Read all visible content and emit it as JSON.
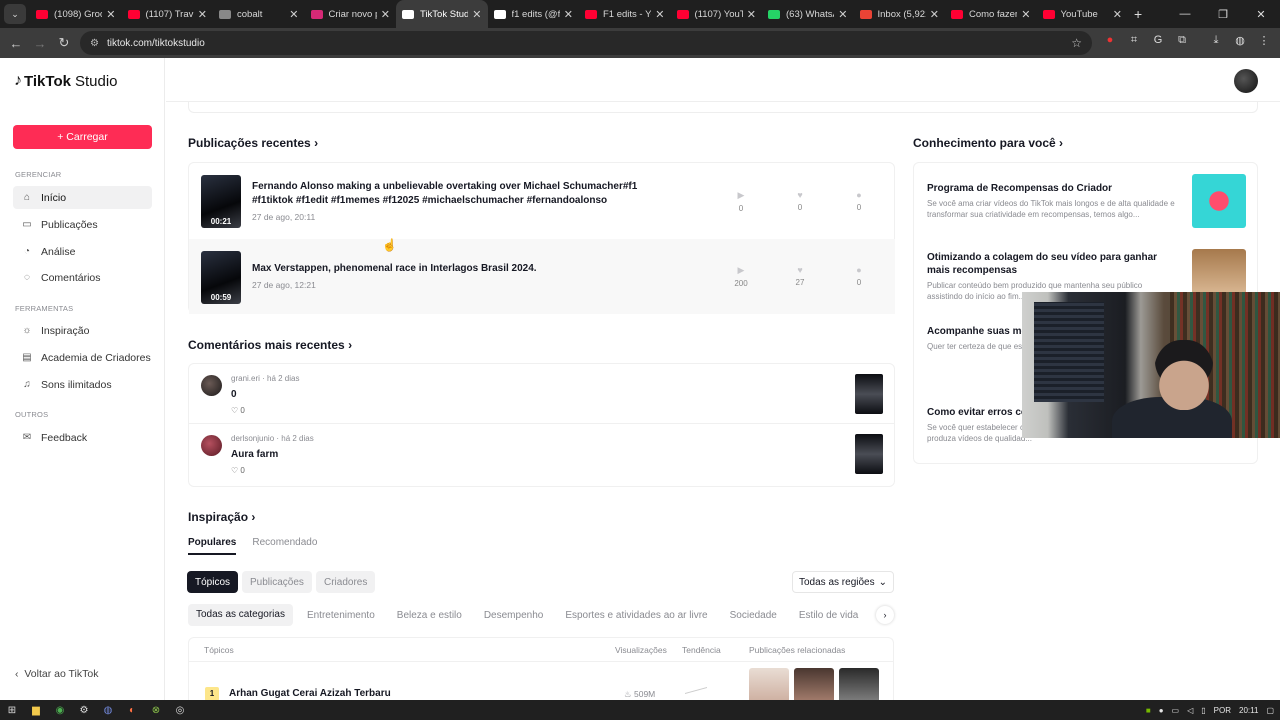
{
  "browser": {
    "tabs": [
      {
        "title": "(1098) Groo",
        "color": "#ff0033"
      },
      {
        "title": "(1107) Travis",
        "color": "#ff0033"
      },
      {
        "title": "cobalt",
        "color": "#888888"
      },
      {
        "title": "Criar novo p",
        "color": "#d62976"
      },
      {
        "title": "TikTok Studio",
        "color": "#ffffff",
        "active": true
      },
      {
        "title": "f1 edits (@f",
        "color": "#ffffff"
      },
      {
        "title": "F1 edits - Yo",
        "color": "#ff0033"
      },
      {
        "title": "(1107) YouTu",
        "color": "#ff0033"
      },
      {
        "title": "(63) WhatsA",
        "color": "#25d366"
      },
      {
        "title": "Inbox (5,921",
        "color": "#ea4335"
      },
      {
        "title": "Como fazer",
        "color": "#ff0033"
      },
      {
        "title": "YouTube",
        "color": "#ff0033"
      }
    ],
    "url": "tiktok.com/tiktokstudio"
  },
  "sidebar": {
    "brand": "TikTok",
    "brand_suffix": "Studio",
    "upload_label": "+ Carregar",
    "section_manage": "GERENCIAR",
    "manage_items": [
      "Início",
      "Publicações",
      "Análise",
      "Comentários"
    ],
    "section_tools": "FERRAMENTAS",
    "tools_items": [
      "Inspiração",
      "Academia de Criadores",
      "Sons ilimitados"
    ],
    "section_others": "OUTROS",
    "others_items": [
      "Feedback"
    ],
    "back_label": "Voltar ao TikTok"
  },
  "recent_posts": {
    "title": "Publicações recentes ›",
    "items": [
      {
        "title": "Fernando Alonso making a unbelievable overtaking over Michael Schumacher#f1 #f1tiktok #f1edit #f1memes #f12025 #michaelschumacher #fernandoalonso",
        "date": "27 de ago, 20:11",
        "duration": "00:21",
        "plays": "0",
        "likes": "0",
        "comments": "0"
      },
      {
        "title": "Max Verstappen, phenomenal race in Interlagos Brasil 2024.",
        "date": "27 de ago, 12:21",
        "duration": "00:59",
        "plays": "200",
        "likes": "27",
        "comments": "0"
      }
    ]
  },
  "recent_comments": {
    "title": "Comentários mais recentes ›",
    "items": [
      {
        "user": "grani.eri · há 2 dias",
        "text": "0",
        "likes": "♡ 0"
      },
      {
        "user": "derlsonjunio · há 2 dias",
        "text": "Aura farm",
        "likes": "♡ 0"
      }
    ]
  },
  "inspiration": {
    "title": "Inspiração ›",
    "tabs": [
      "Populares",
      "Recomendado"
    ],
    "pills": [
      "Tópicos",
      "Publicações",
      "Criadores"
    ],
    "region": "Todas as regiões",
    "categories": [
      "Todas as categorias",
      "Entretenimento",
      "Beleza e estilo",
      "Desempenho",
      "Esportes e atividades ao ar livre",
      "Sociedade",
      "Estilo de vida",
      "V"
    ],
    "table_headers": [
      "Tópicos",
      "Visualizações",
      "Tendência",
      "Publicações relacionadas"
    ],
    "rows": [
      {
        "rank": "1",
        "topic": "Arhan Gugat Cerai Azizah Terbaru",
        "views": "509M"
      }
    ]
  },
  "knowledge": {
    "title": "Conhecimento para você ›",
    "items": [
      {
        "title": "Programa de Recompensas do Criador",
        "desc": "Se você ama criar vídeos do TikTok mais longos e de alta qualidade e transformar sua criatividade em recompensas, temos algo..."
      },
      {
        "title": "Otimizando a colagem do seu vídeo para ganhar mais recompensas",
        "desc": "Publicar conteúdo bem produzido que mantenha seu público assistindo do início ao fim..."
      },
      {
        "title": "Acompanhe suas men Criador",
        "desc": "Quer ter certeza de que es pedidos de colaboração, c"
      },
      {
        "title": "Como evitar erros con",
        "desc": "Se você quer estabelecer carreira com conteúdo especializado, produza vídeos de qualidad..."
      }
    ]
  },
  "taskbar": {
    "lang": "POR",
    "time": "20:11"
  }
}
